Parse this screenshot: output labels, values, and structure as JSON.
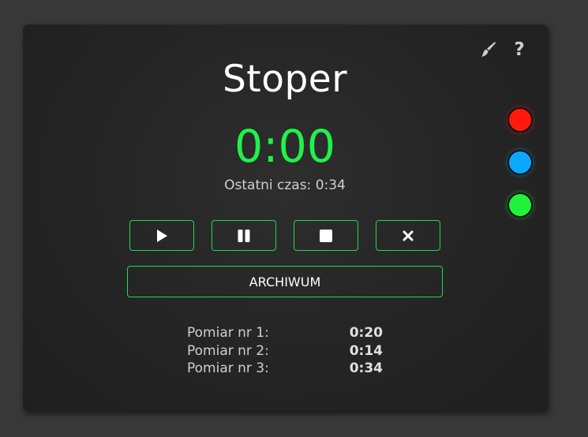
{
  "app": {
    "title": "Stoper",
    "time": "0:00",
    "last_time": "Ostatni czas: 0:34"
  },
  "toolbar": {
    "theme_icon": "brush-icon",
    "help_label": "?"
  },
  "controls": {
    "play_icon": "play-icon",
    "pause_icon": "pause-icon",
    "stop_icon": "stop-icon",
    "reset_icon": "close-icon",
    "archive_label": "ARCHIWUM"
  },
  "results": [
    {
      "label": "Pomiar nr 1:",
      "value": "0:20"
    },
    {
      "label": "Pomiar nr 2:",
      "value": "0:14"
    },
    {
      "label": "Pomiar nr 3:",
      "value": "0:34"
    }
  ],
  "theme_colors": [
    {
      "name": "red",
      "color": "#ff1a0d"
    },
    {
      "name": "blue",
      "color": "#0aa8ff"
    },
    {
      "name": "green",
      "color": "#1ff23a"
    }
  ],
  "accent_color": "#1ff24a"
}
